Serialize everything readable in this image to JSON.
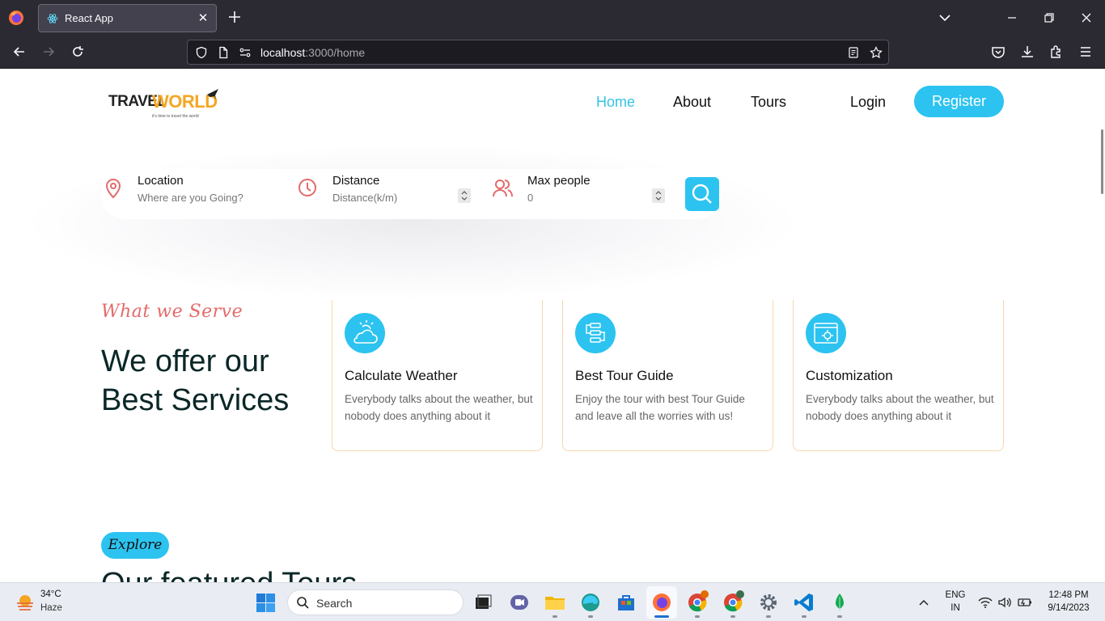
{
  "browser": {
    "tab_title": "React App",
    "url_host": "localhost",
    "url_path": ":3000/home"
  },
  "site": {
    "logo_travel": "TRAVEL",
    "logo_world": "WORLD",
    "logo_tagline": "it's time to travel the world",
    "nav": {
      "home": "Home",
      "about": "About",
      "tours": "Tours",
      "login": "Login",
      "register": "Register"
    },
    "search": {
      "location_label": "Location",
      "location_placeholder": "Where are you Going?",
      "distance_label": "Distance",
      "distance_placeholder": "Distance(k/m)",
      "people_label": "Max people",
      "people_placeholder": "0"
    },
    "services": {
      "subtitle": "What we Serve",
      "title": "We offer our Best Services",
      "cards": [
        {
          "title": "Calculate Weather",
          "text": "Everybody talks about the weather, but nobody does anything about it"
        },
        {
          "title": "Best Tour Guide",
          "text": "Enjoy the tour with best Tour Guide and leave all the worries with us!"
        },
        {
          "title": "Customization",
          "text": "Everybody talks about the weather, but nobody does anything about it"
        }
      ]
    },
    "featured": {
      "badge": "Explore",
      "title": "Our featured Tours"
    }
  },
  "taskbar": {
    "temperature": "34°C",
    "weather": "Haze",
    "search": "Search",
    "lang": "ENG",
    "region": "IN",
    "time": "12:48 PM",
    "date": "9/14/2023"
  },
  "colors": {
    "accent": "#2cc3f0",
    "secondary": "#e36b6b",
    "heading": "#0b2727"
  }
}
